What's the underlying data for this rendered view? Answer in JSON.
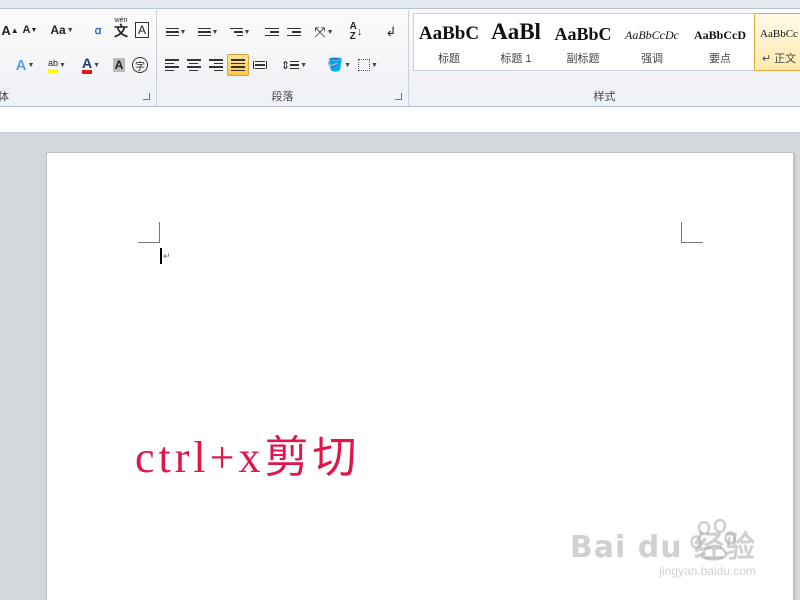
{
  "ribbon": {
    "font_group": {
      "label": "体",
      "grow_font": "A",
      "shrink_font": "A",
      "change_case": "Aa",
      "phonetic_guide": "wén",
      "phonetic_char": "文",
      "char_border": "A",
      "font_color": "A",
      "char_shading": "A",
      "enclose_char": "字"
    },
    "paragraph_group": {
      "label": "段落"
    },
    "styles_group": {
      "label": "样式",
      "items": [
        {
          "sample": "AaBbC",
          "caption": "标题"
        },
        {
          "sample": "AaBl",
          "caption": "标题 1"
        },
        {
          "sample": "AaBbC",
          "caption": "副标题"
        },
        {
          "sample": "AaBbCcDc",
          "caption": "强调"
        },
        {
          "sample": "AaBbCcD",
          "caption": "要点"
        },
        {
          "sample": "AaBbCc",
          "caption": "↵ 正文"
        }
      ]
    }
  },
  "document": {
    "content_text": "ctrl+x剪切"
  },
  "watermark": {
    "brand": "Bai du 经验",
    "url": "jingyan.baidu.com"
  },
  "colors": {
    "content_text": "#e0154a",
    "active_button": "#ffc84a"
  }
}
